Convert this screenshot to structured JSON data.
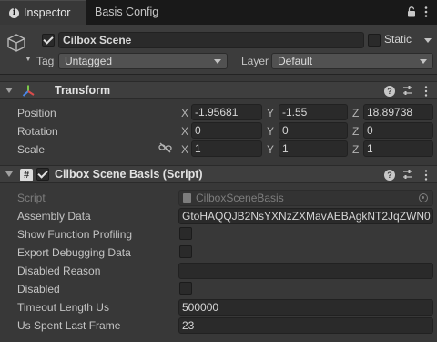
{
  "tabs": {
    "inspector_label": "Inspector",
    "basis_config_label": "Basis Config"
  },
  "header": {
    "object_name": "Cilbox Scene",
    "active_checked": true,
    "static_label": "Static",
    "static_checked": false,
    "tag_label": "Tag",
    "tag_value": "Untagged",
    "layer_label": "Layer",
    "layer_value": "Default"
  },
  "transform": {
    "title": "Transform",
    "position_label": "Position",
    "rotation_label": "Rotation",
    "scale_label": "Scale",
    "axis_x": "X",
    "axis_y": "Y",
    "axis_z": "Z",
    "position": {
      "x": "-1.95681",
      "y": "-1.55",
      "z": "18.89738"
    },
    "rotation": {
      "x": "0",
      "y": "0",
      "z": "0"
    },
    "scale": {
      "x": "1",
      "y": "1",
      "z": "1"
    }
  },
  "script_component": {
    "title": "Cilbox Scene Basis (Script)",
    "enabled_checked": true,
    "script_label": "Script",
    "script_value": "CilboxSceneBasis",
    "fields": {
      "assembly_data_label": "Assembly Data",
      "assembly_data_value": "GtoHAQQJB2NsYXNzZXMavAEBAgkNT2JqZWN0",
      "show_function_profiling_label": "Show Function Profiling",
      "show_function_profiling_checked": false,
      "export_debugging_data_label": "Export Debugging Data",
      "export_debugging_data_checked": false,
      "disabled_reason_label": "Disabled Reason",
      "disabled_reason_value": "",
      "disabled_label": "Disabled",
      "disabled_checked": false,
      "timeout_length_label": "Timeout Length Us",
      "timeout_length_value": "500000",
      "us_spent_last_frame_label": "Us Spent Last Frame",
      "us_spent_last_frame_value": "23"
    }
  },
  "colors": {
    "background": "#383838",
    "tab_bar": "#191919",
    "field_bg": "#2a2a2a",
    "transform_x_axis": "#d94c4c",
    "transform_y_axis": "#7cc84a",
    "transform_z_axis": "#4a86e8"
  }
}
